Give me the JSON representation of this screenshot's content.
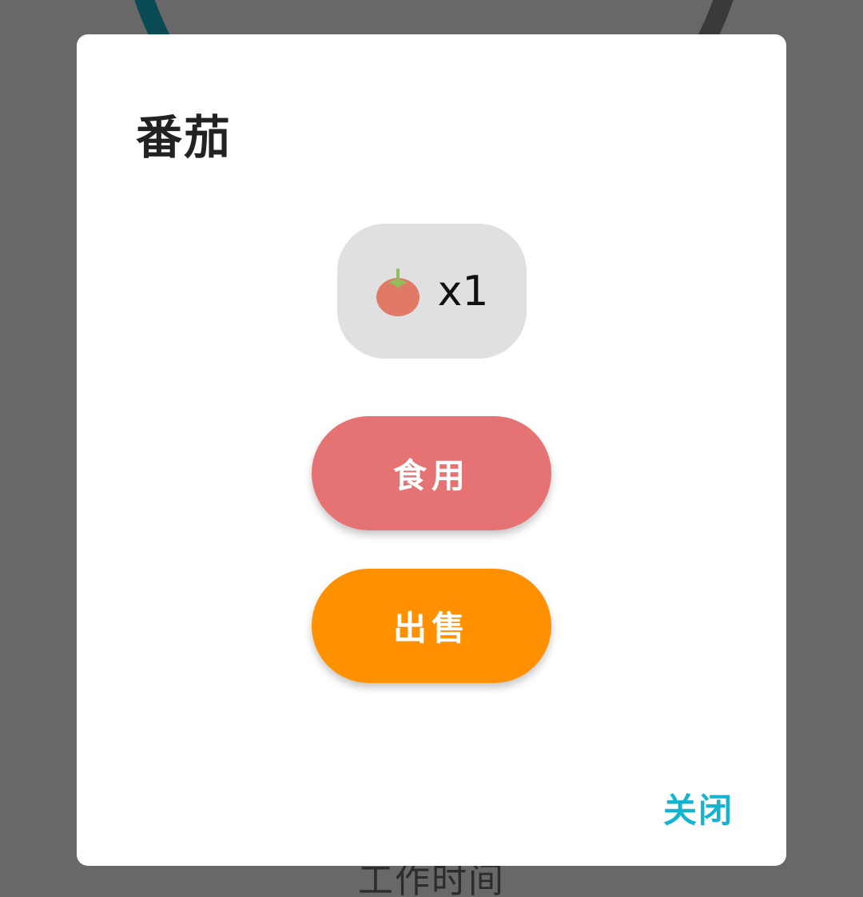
{
  "background": {
    "label": "工作时间"
  },
  "dialog": {
    "title": "番茄",
    "item": {
      "icon": "tomato-icon",
      "count": "x1"
    },
    "buttons": {
      "eat_label": "食用",
      "sell_label": "出售",
      "close_label": "关闭"
    }
  },
  "colors": {
    "eat_button": "#e57373",
    "sell_button": "#ff9100",
    "close_text": "#14b4d0",
    "scrim": "#686868"
  }
}
